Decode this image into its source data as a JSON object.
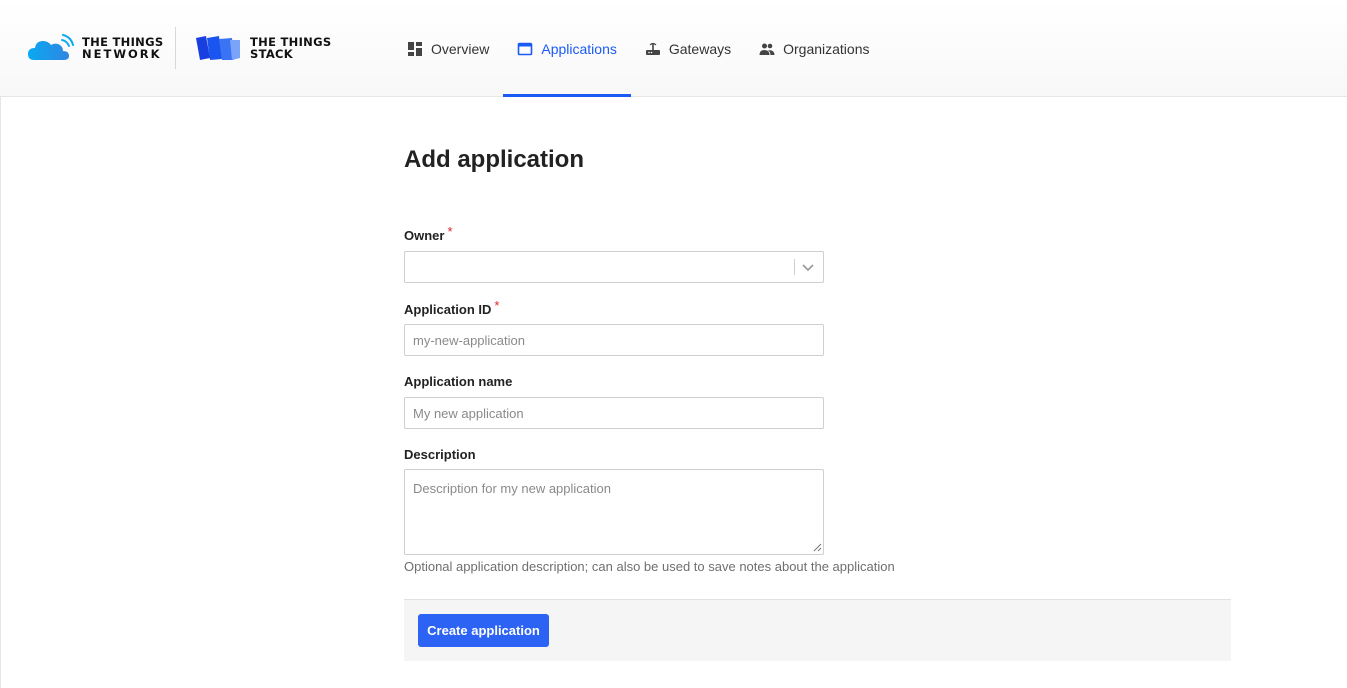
{
  "brand": {
    "network_line1": "THE THINGS",
    "network_line2": "NETWORK",
    "stack_line1": "THE THINGS",
    "stack_line2": "STACK"
  },
  "nav": {
    "items": [
      {
        "label": "Overview",
        "icon": "dashboard-icon",
        "active": false
      },
      {
        "label": "Applications",
        "icon": "application-window-icon",
        "active": true
      },
      {
        "label": "Gateways",
        "icon": "router-icon",
        "active": false
      },
      {
        "label": "Organizations",
        "icon": "people-icon",
        "active": false
      }
    ]
  },
  "page": {
    "title": "Add application"
  },
  "form": {
    "owner_label": "Owner",
    "owner_value": "",
    "app_id_label": "Application ID",
    "app_id_placeholder": "my-new-application",
    "app_name_label": "Application name",
    "app_name_placeholder": "My new application",
    "description_label": "Description",
    "description_placeholder": "Description for my new application",
    "description_hint": "Optional application description; can also be used to save notes about the application",
    "required_mark": "*",
    "submit_label": "Create application"
  },
  "colors": {
    "accent": "#1a5bf6",
    "button": "#2c63f5",
    "required": "#e02424"
  }
}
